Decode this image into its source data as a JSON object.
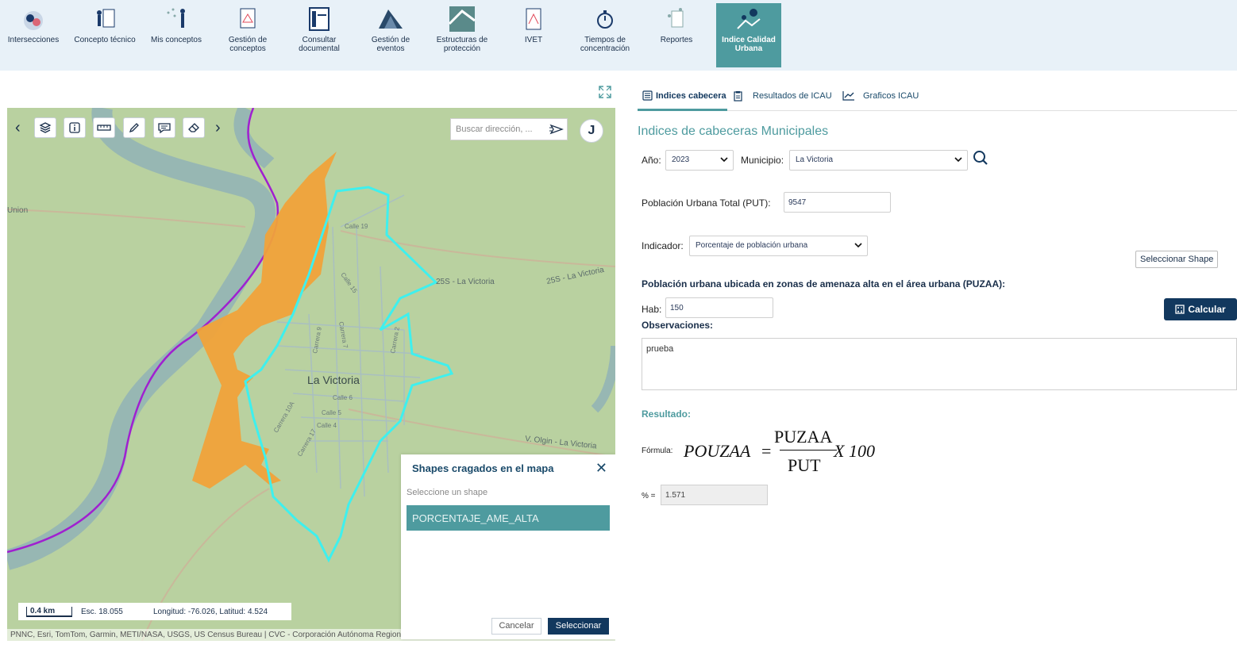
{
  "nav": {
    "items": [
      {
        "label": "Intersecciones",
        "icon": "intersections-icon"
      },
      {
        "label": "Concepto técnico",
        "icon": "technical-concept-icon"
      },
      {
        "label": "Mis conceptos",
        "icon": "my-concepts-icon"
      },
      {
        "label": "Gestión de conceptos",
        "icon": "concept-management-icon"
      },
      {
        "label": "Consultar documental",
        "icon": "document-query-icon"
      },
      {
        "label": "Gestión de eventos",
        "icon": "event-management-icon"
      },
      {
        "label": "Estructuras de protección",
        "icon": "protection-structures-icon"
      },
      {
        "label": "IVET",
        "icon": "ivet-icon"
      },
      {
        "label": "Tiempos de concentración",
        "icon": "stopwatch-icon"
      },
      {
        "label": "Reportes",
        "icon": "reports-icon"
      },
      {
        "label": "Indice Calidad Urbana",
        "icon": "urban-quality-icon",
        "active": true
      }
    ]
  },
  "map": {
    "search_placeholder": "Buscar dirección, ...",
    "avatar_letter": "J",
    "town_label": "La Victoria",
    "road_labels": [
      "25S - La Victoria",
      "25S - La Victoria",
      "Union",
      "V. Olgin - La Victoria"
    ],
    "street_labels": [
      "Calle 19",
      "Calle 15",
      "Carrera 9",
      "Carrera 7",
      "Carrera 2",
      "Calle 6",
      "Calle 5",
      "Calle 4",
      "Carrera 10A",
      "Carrera 17"
    ],
    "scale_km": "0.4 km",
    "scale_esc": "Esc. 18.055",
    "coords": "Longitud: -76.026, Latitud: 4.524",
    "attribution": "PNNC, Esri, TomTom, Garmin, METI/NASA, USGS, US Census Bureau | CVC - Corporación Autónoma Regional del Valle del Cauca"
  },
  "shapes_panel": {
    "title": "Shapes cragados en el mapa",
    "subtitle": "Seleccione un shape",
    "item": "PORCENTAJE_AME_ALTA",
    "cancel": "Cancelar",
    "select": "Seleccionar"
  },
  "tabs": [
    {
      "label": "Indices cabecera",
      "icon": "list-icon",
      "active": true
    },
    {
      "label": "Resultados de ICAU",
      "icon": "clipboard-icon"
    },
    {
      "label": "Graficos ICAU",
      "icon": "line-chart-icon"
    }
  ],
  "form": {
    "title": "Indices de cabeceras Municipales",
    "year_label": "Año:",
    "year_value": "2023",
    "municipio_label": "Municipio:",
    "municipio_value": "La Victoria",
    "put_label": "Población Urbana Total (PUT):",
    "put_value": "9547",
    "indicador_label": "Indicador:",
    "indicador_value": "Porcentaje de población urbana",
    "select_shape": "Seleccionar Shape",
    "puzaa_label": "Población urbana ubicada en zonas de amenaza alta en el área urbana (PUZAA):",
    "hab_label": "Hab:",
    "hab_value": "150",
    "calcular": "Calcular",
    "obs_label": "Observaciones:",
    "obs_value": "prueba",
    "result_label": "Resultado:",
    "formula_label": "Fórmula:",
    "formula_lhs": "POUZAA",
    "formula_num": "PUZAA",
    "formula_den": "PUT",
    "formula_rhs": "X 100",
    "pct_label": "% =",
    "pct_value": "1.571"
  },
  "colors": {
    "accent": "#4e9b9f",
    "primary": "#12385e",
    "hazard_fill": "#f0a23a",
    "urban_outline": "#3ef0ee",
    "boundary": "#a020d0"
  }
}
